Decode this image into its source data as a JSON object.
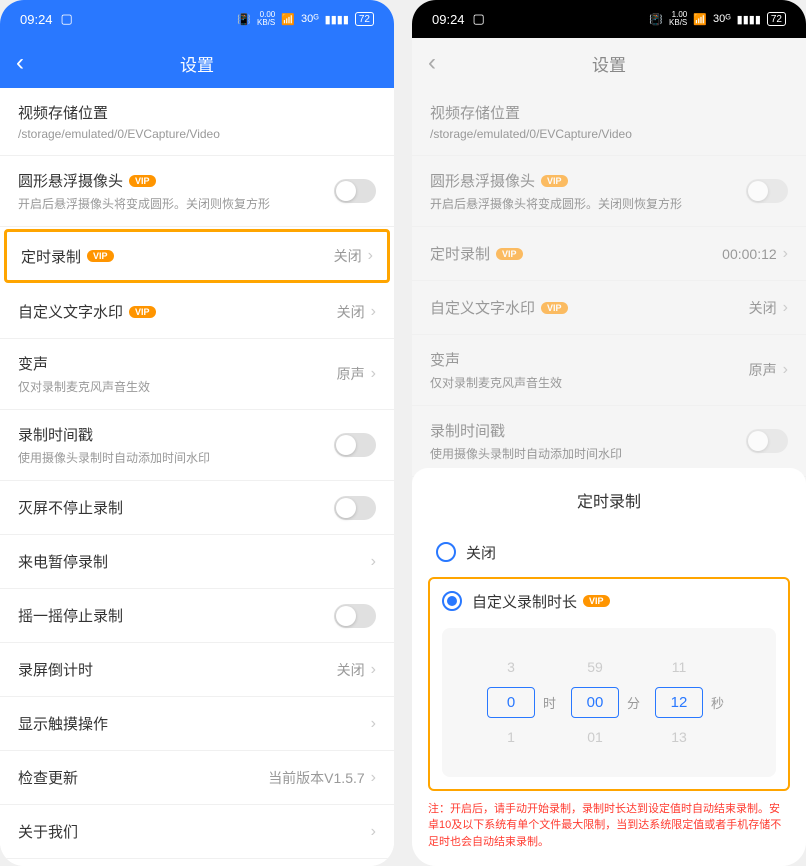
{
  "status": {
    "time": "09:24",
    "speed_left": "0.00\nKB/S",
    "speed_right": "1.00\nKB/S",
    "signal": "30ᴳ",
    "battery": "72"
  },
  "header": {
    "title": "设置"
  },
  "rows": {
    "storage": {
      "title": "视频存储位置",
      "sub": "/storage/emulated/0/EVCapture/Video"
    },
    "floatcam": {
      "title": "圆形悬浮摄像头",
      "sub": "开启后悬浮摄像头将变成圆形。关闭则恢复方形",
      "vip": "VIP"
    },
    "timer": {
      "title": "定时录制",
      "vip": "VIP",
      "value_left": "关闭",
      "value_right": "00:00:12"
    },
    "watermark": {
      "title": "自定义文字水印",
      "vip": "VIP",
      "value": "关闭"
    },
    "voice": {
      "title": "变声",
      "sub": "仅对录制麦克风声音生效",
      "value": "原声"
    },
    "timestamp": {
      "title": "录制时间戳",
      "sub": "使用摄像头录制时自动添加时间水印"
    },
    "screenoff": {
      "title": "灭屏不停止录制"
    },
    "incoming": {
      "title": "来电暂停录制"
    },
    "shake": {
      "title": "摇一摇停止录制"
    },
    "countdown": {
      "title": "录屏倒计时",
      "value": "关闭"
    },
    "touches": {
      "title": "显示触摸操作"
    },
    "update": {
      "title": "检查更新",
      "value": "当前版本V1.5.7"
    },
    "about": {
      "title": "关于我们"
    }
  },
  "sheet": {
    "title": "定时录制",
    "opt_off": "关闭",
    "opt_custom": "自定义录制时长",
    "vip": "VIP",
    "picker": {
      "prev": {
        "h": "3",
        "m": "59",
        "s": "11"
      },
      "curr": {
        "h": "0",
        "m": "00",
        "s": "12"
      },
      "next": {
        "h": "1",
        "m": "01",
        "s": "13"
      },
      "unit_h": "时",
      "unit_m": "分",
      "unit_s": "秒"
    },
    "note": "注：开启后，请手动开始录制，录制时长达到设定值时自动结束录制。安卓10及以下系统有单个文件最大限制，当到达系统限定值或者手机存储不足时也会自动结束录制。"
  }
}
